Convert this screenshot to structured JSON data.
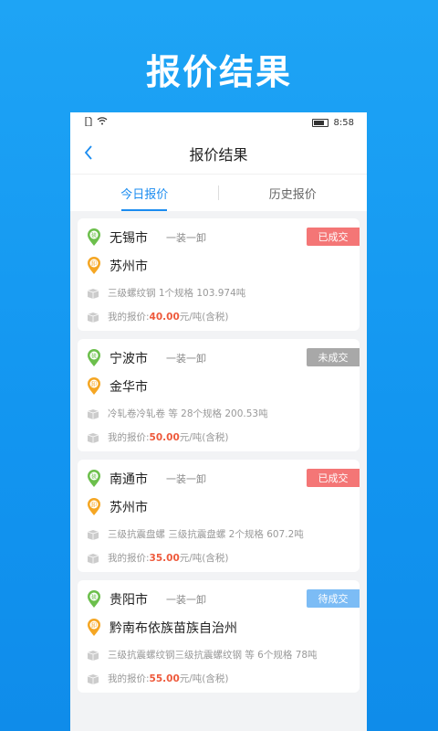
{
  "hero_title": "报价结果",
  "statusbar": {
    "time": "8:58"
  },
  "nav": {
    "title": "报价结果"
  },
  "tabs": [
    {
      "label": "今日报价"
    },
    {
      "label": "历史报价"
    }
  ],
  "colors": {
    "accent": "#1b8cf0",
    "done": "#f47676",
    "not_done": "#a8a8a8",
    "pending": "#7cbcf5",
    "price": "#ee5a3c",
    "load_pin": "#6cbf4c",
    "unload_pin": "#f5a623"
  },
  "pin_labels": {
    "load": "装",
    "unload": "卸"
  },
  "quotes": [
    {
      "from": "无锡市",
      "mode": "一装一卸",
      "to": "苏州市",
      "status": "已成交",
      "goods": "三级螺纹钢  1个规格 103.974吨",
      "price_prefix": "我的报价:",
      "price": "40.00",
      "price_suffix": "元/吨(含税)"
    },
    {
      "from": "宁波市",
      "mode": "一装一卸",
      "to": "金华市",
      "status": "未成交",
      "goods": "冷轧卷冷轧卷 等 28个规格 200.53吨",
      "price_prefix": "我的报价:",
      "price": "50.00",
      "price_suffix": "元/吨(含税)"
    },
    {
      "from": "南通市",
      "mode": "一装一卸",
      "to": "苏州市",
      "status": "已成交",
      "goods": "三级抗震盘螺 三级抗震盘螺  2个规格 607.2吨",
      "price_prefix": "我的报价:",
      "price": "35.00",
      "price_suffix": "元/吨(含税)"
    },
    {
      "from": "贵阳市",
      "mode": "一装一卸",
      "to": "黔南布依族苗族自治州",
      "status": "待成交",
      "goods": "三级抗震螺纹钢三级抗震螺纹钢 等 6个规格 78吨",
      "price_prefix": "我的报价:",
      "price": "55.00",
      "price_suffix": "元/吨(含税)"
    }
  ]
}
